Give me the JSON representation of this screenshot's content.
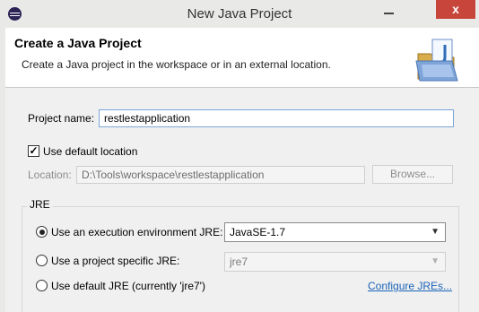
{
  "window": {
    "title": "New Java Project",
    "app_icon": "eclipse-icon",
    "minimize_icon": "minimize-icon",
    "close_icon": "close-icon",
    "close_glyph": "x",
    "close_color": "#c7453b"
  },
  "header": {
    "title": "Create a Java Project",
    "description": "Create a Java project in the workspace or in an external location.",
    "icon": "java-project-folder-icon"
  },
  "project_name": {
    "label": "Project name:",
    "value": "restlestapplication"
  },
  "default_location": {
    "label": "Use default location",
    "checked": true
  },
  "location": {
    "label": "Location:",
    "value": "D:\\Tools\\workspace\\restlestapplication",
    "browse_label": "Browse..."
  },
  "jre": {
    "group_label": "JRE",
    "options": [
      {
        "label": "Use an execution environment JRE:",
        "selected": true,
        "select_value": "JavaSE-1.7",
        "enabled": true
      },
      {
        "label": "Use a project specific JRE:",
        "selected": false,
        "select_value": "jre7",
        "enabled": false
      },
      {
        "label": "Use default JRE (currently 'jre7')",
        "selected": false
      }
    ],
    "configure_link": "Configure JREs..."
  },
  "colors": {
    "accent": "#1a63b8",
    "field_border": "#7aa6d8"
  }
}
